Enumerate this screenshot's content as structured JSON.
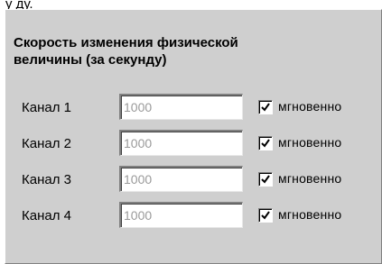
{
  "clipped_text": "у ду.",
  "panel": {
    "title": "Скорость изменения физической\nвеличины  (за секунду)"
  },
  "channels": [
    {
      "label": "Канал 1",
      "value": "1000",
      "checkbox_label": "мгновенно",
      "checked": true
    },
    {
      "label": "Канал 2",
      "value": "1000",
      "checkbox_label": "мгновенно",
      "checked": true
    },
    {
      "label": "Канал 3",
      "value": "1000",
      "checkbox_label": "мгновенно",
      "checked": true
    },
    {
      "label": "Канал 4",
      "value": "1000",
      "checkbox_label": "мгновенно",
      "checked": true
    }
  ]
}
